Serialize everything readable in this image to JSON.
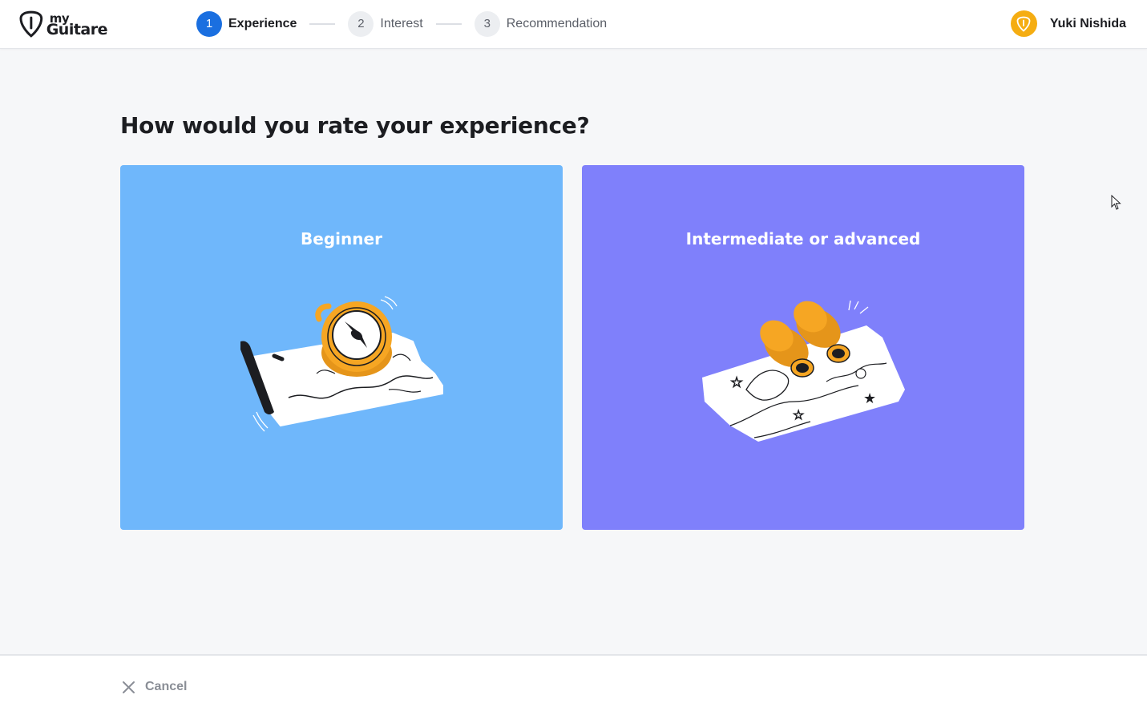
{
  "header": {
    "logo": {
      "line1": "my",
      "line2": "Guitare"
    },
    "steps": [
      {
        "number": "1",
        "label": "Experience",
        "active": true
      },
      {
        "number": "2",
        "label": "Interest",
        "active": false
      },
      {
        "number": "3",
        "label": "Recommendation",
        "active": false
      }
    ],
    "user": {
      "name": "Yuki Nishida",
      "avatar_icon": "guitar-pick-icon"
    }
  },
  "main": {
    "question": "How would you rate your experience?",
    "options": [
      {
        "label": "Beginner",
        "color": "#6fb7fb",
        "illustration": "compass-map-icon"
      },
      {
        "label": "Intermediate or advanced",
        "color": "#7f80fb",
        "illustration": "binoculars-map-icon"
      }
    ]
  },
  "footer": {
    "cancel_label": "Cancel"
  },
  "colors": {
    "accent": "#1a6fe0",
    "avatar": "#f5ad12",
    "illustration_orange": "#f6a623"
  }
}
